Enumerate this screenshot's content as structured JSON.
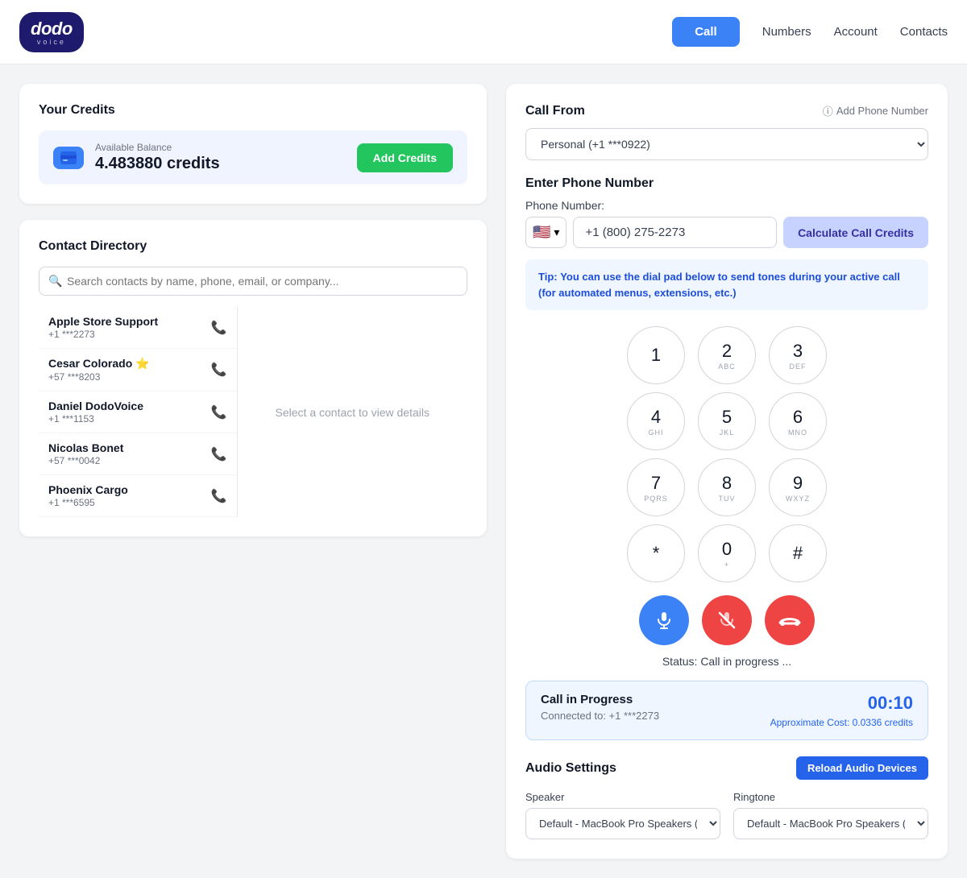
{
  "header": {
    "logo_text": "dodo",
    "logo_sub": "voice",
    "nav": {
      "call_label": "Call",
      "numbers_label": "Numbers",
      "account_label": "Account",
      "contacts_label": "Contacts"
    }
  },
  "credits": {
    "title": "Your Credits",
    "balance_label": "Available Balance",
    "balance_amount": "4.483880 credits",
    "add_credits_label": "Add Credits"
  },
  "contact_directory": {
    "title": "Contact Directory",
    "search_placeholder": "Search contacts by name, phone, email, or company...",
    "select_prompt": "Select a contact to view details",
    "contacts": [
      {
        "name": "Apple Store Support",
        "phone": "+1 ***2273",
        "starred": false
      },
      {
        "name": "Cesar Colorado ⭐",
        "phone": "+57 ***8203",
        "starred": true
      },
      {
        "name": "Daniel DodoVoice",
        "phone": "+1 ***1153",
        "starred": false
      },
      {
        "name": "Nicolas Bonet",
        "phone": "+57 ***0042",
        "starred": false
      },
      {
        "name": "Phoenix Cargo",
        "phone": "+1 ***6595",
        "starred": false
      }
    ]
  },
  "call_from": {
    "title": "Call From",
    "add_phone_label": "Add Phone Number",
    "selected_option": "Personal (+1 ***0922)",
    "options": [
      "Personal (+1 ***0922)"
    ]
  },
  "enter_phone": {
    "title": "Enter Phone Number",
    "phone_label": "Phone Number:",
    "flag_emoji": "🇺🇸",
    "phone_value": "+1 (800) 275-2273",
    "calc_label": "Calculate Call Credits"
  },
  "tip": {
    "prefix": "Tip:",
    "text": "You can use the dial pad below to send tones during your active call (for automated menus, extensions, etc.)"
  },
  "dialpad": {
    "keys": [
      {
        "num": "1",
        "sub": ""
      },
      {
        "num": "2",
        "sub": "ABC"
      },
      {
        "num": "3",
        "sub": "DEF"
      },
      {
        "num": "4",
        "sub": "GHI"
      },
      {
        "num": "5",
        "sub": "JKL"
      },
      {
        "num": "6",
        "sub": "MNO"
      },
      {
        "num": "7",
        "sub": "PQRS"
      },
      {
        "num": "8",
        "sub": "TUV"
      },
      {
        "num": "9",
        "sub": "WXYZ"
      },
      {
        "num": "*",
        "sub": ""
      },
      {
        "num": "0",
        "sub": "+"
      },
      {
        "num": "#",
        "sub": ""
      }
    ]
  },
  "status": {
    "text": "Status: Call in progress ..."
  },
  "call_progress": {
    "title": "Call in Progress",
    "connected_to": "Connected to: +1 ***2273",
    "timer": "00:10",
    "cost_label": "Approximate Cost: 0.0336 credits"
  },
  "audio_settings": {
    "title": "Audio Settings",
    "reload_label": "Reload Audio Devices",
    "speaker_label": "Speaker",
    "speaker_value": "Default - MacBook Pro Speakers (Bu",
    "ringtone_label": "Ringtone",
    "ringtone_value": "Default - MacBook Pro Speakers (Bu"
  }
}
